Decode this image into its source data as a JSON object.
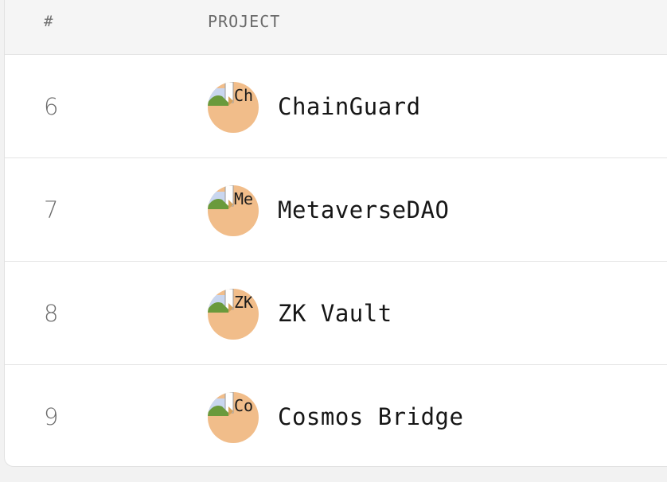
{
  "table": {
    "headers": {
      "number": "#",
      "project": "PROJECT"
    },
    "rows": [
      {
        "number": "6",
        "name": "ChainGuard",
        "avatar_alt": "Ch"
      },
      {
        "number": "7",
        "name": "MetaverseDAO",
        "avatar_alt": "Me"
      },
      {
        "number": "8",
        "name": "ZK Vault",
        "avatar_alt": "ZK"
      },
      {
        "number": "9",
        "name": "Cosmos Bridge",
        "avatar_alt": "Co"
      }
    ]
  },
  "colors": {
    "avatar_background": "#f1bd8a",
    "header_background": "#f5f5f5",
    "page_background": "#f2f2f2"
  },
  "icons": {
    "avatar_placeholder": "broken-image-icon"
  }
}
